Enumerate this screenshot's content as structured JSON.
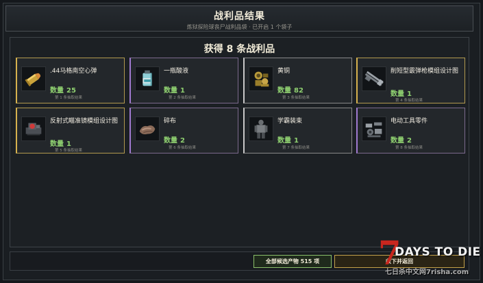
{
  "header": {
    "title": "战利品结果",
    "subtitle": "炼狱探险球丧尸战利品袋 · 已开启 1 个袋子"
  },
  "panel": {
    "title": "获得 8 条战利品"
  },
  "qty_label": "数量",
  "items": [
    {
      "name": ".44马格南空心弹",
      "qty": "25",
      "rank": "第 1 条抽取结果",
      "rarity": "gold",
      "icon": "ammo-icon"
    },
    {
      "name": "一瓶酸液",
      "qty": "1",
      "rank": "第 2 条抽取结果",
      "rarity": "purple",
      "icon": "acid-bottle-icon"
    },
    {
      "name": "黄铜",
      "qty": "82",
      "rank": "第 3 条抽取结果",
      "rarity": "gray",
      "icon": "brass-icon"
    },
    {
      "name": "削短型霰弹枪模组设计图",
      "qty": "1",
      "rank": "第 4 条抽取结果",
      "rarity": "gold",
      "icon": "shotgun-schematic-icon"
    },
    {
      "name": "反射式瞄准镜模组设计图",
      "qty": "1",
      "rank": "第 5 条抽取结果",
      "rarity": "gold",
      "icon": "reflex-sight-icon"
    },
    {
      "name": "碎布",
      "qty": "2",
      "rank": "第 6 条抽取结果",
      "rarity": "purple",
      "icon": "cloth-icon"
    },
    {
      "name": "学霸装束",
      "qty": "1",
      "rank": "第 7 条抽取结果",
      "rarity": "gray",
      "icon": "outfit-icon"
    },
    {
      "name": "电动工具零件",
      "qty": "2",
      "rank": "第 8 条抽取结果",
      "rarity": "purple",
      "icon": "tool-parts-icon"
    }
  ],
  "footer": {
    "all_candidates": "全部候选产物 515 项",
    "collect": "收下并返回"
  },
  "watermark": {
    "seven": "7",
    "brand": "DAYS TO DIE",
    "site": "七日杀中文网7risha.com"
  },
  "colors": {
    "gold": "#d7b24e",
    "purple": "#a07ad0",
    "gray": "#c8c8c8",
    "qty_green": "#8fd070"
  }
}
